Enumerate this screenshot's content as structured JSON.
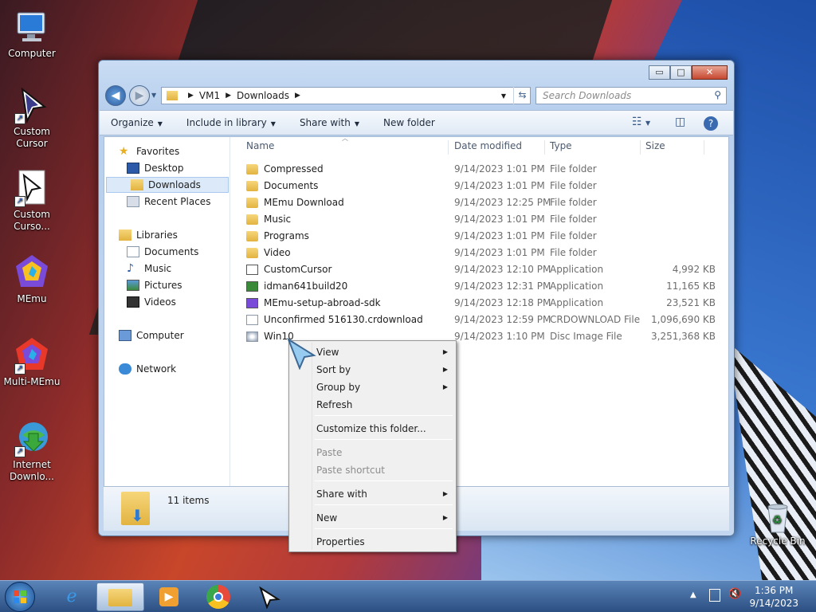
{
  "desktop": {
    "icons": [
      {
        "label": "Computer"
      },
      {
        "label": "Custom Cursor"
      },
      {
        "label": "Custom Curso..."
      },
      {
        "label": "MEmu"
      },
      {
        "label": "Multi-MEmu"
      },
      {
        "label": "Internet Downlo..."
      },
      {
        "label": "Recycle Bin"
      }
    ]
  },
  "window": {
    "buttons": {
      "minimize": "▭",
      "maximize": "□",
      "close": "✕"
    },
    "address": {
      "crumbs": [
        "VM1",
        "Downloads"
      ]
    },
    "search": {
      "placeholder": "Search Downloads"
    },
    "toolbar": {
      "items": [
        "Organize",
        "Include in library",
        "Share with",
        "New folder"
      ]
    },
    "sidebar": {
      "items": [
        {
          "label": "Favorites",
          "kind": "header"
        },
        {
          "label": "Desktop"
        },
        {
          "label": "Downloads",
          "selected": true
        },
        {
          "label": "Recent Places"
        },
        {
          "label": "Libraries",
          "kind": "header"
        },
        {
          "label": "Documents"
        },
        {
          "label": "Music"
        },
        {
          "label": "Pictures"
        },
        {
          "label": "Videos"
        },
        {
          "label": "Computer",
          "kind": "header"
        },
        {
          "label": "Network",
          "kind": "header"
        }
      ]
    },
    "columns": [
      "Name",
      "Date modified",
      "Type",
      "Size"
    ],
    "files": [
      {
        "name": "Compressed",
        "date": "9/14/2023 1:01 PM",
        "type": "File folder",
        "size": ""
      },
      {
        "name": "Documents",
        "date": "9/14/2023 1:01 PM",
        "type": "File folder",
        "size": ""
      },
      {
        "name": "MEmu Download",
        "date": "9/14/2023 12:25 PM",
        "type": "File folder",
        "size": ""
      },
      {
        "name": "Music",
        "date": "9/14/2023 1:01 PM",
        "type": "File folder",
        "size": ""
      },
      {
        "name": "Programs",
        "date": "9/14/2023 1:01 PM",
        "type": "File folder",
        "size": ""
      },
      {
        "name": "Video",
        "date": "9/14/2023 1:01 PM",
        "type": "File folder",
        "size": ""
      },
      {
        "name": "CustomCursor",
        "date": "9/14/2023 12:10 PM",
        "type": "Application",
        "size": "4,992 KB"
      },
      {
        "name": "idman641build20",
        "date": "9/14/2023 12:31 PM",
        "type": "Application",
        "size": "11,165 KB"
      },
      {
        "name": "MEmu-setup-abroad-sdk",
        "date": "9/14/2023 12:18 PM",
        "type": "Application",
        "size": "23,521 KB"
      },
      {
        "name": "Unconfirmed 516130.crdownload",
        "date": "9/14/2023 12:59 PM",
        "type": "CRDOWNLOAD File",
        "size": "1,096,690 KB"
      },
      {
        "name": "Win10",
        "date": "9/14/2023 1:10 PM",
        "type": "Disc Image File",
        "size": "3,251,368 KB"
      }
    ],
    "status": {
      "count": "11 items"
    }
  },
  "context_menu": {
    "items": [
      {
        "label": "View",
        "submenu": true
      },
      {
        "label": "Sort by",
        "submenu": true
      },
      {
        "label": "Group by",
        "submenu": true
      },
      {
        "label": "Refresh"
      },
      {
        "label": "Customize this folder..."
      },
      {
        "label": "Paste",
        "disabled": true
      },
      {
        "label": "Paste shortcut",
        "disabled": true
      },
      {
        "label": "Share with",
        "submenu": true
      },
      {
        "label": "New",
        "submenu": true
      },
      {
        "label": "Properties"
      }
    ]
  },
  "taskbar": {
    "time": "1:36 PM",
    "date": "9/14/2023"
  }
}
